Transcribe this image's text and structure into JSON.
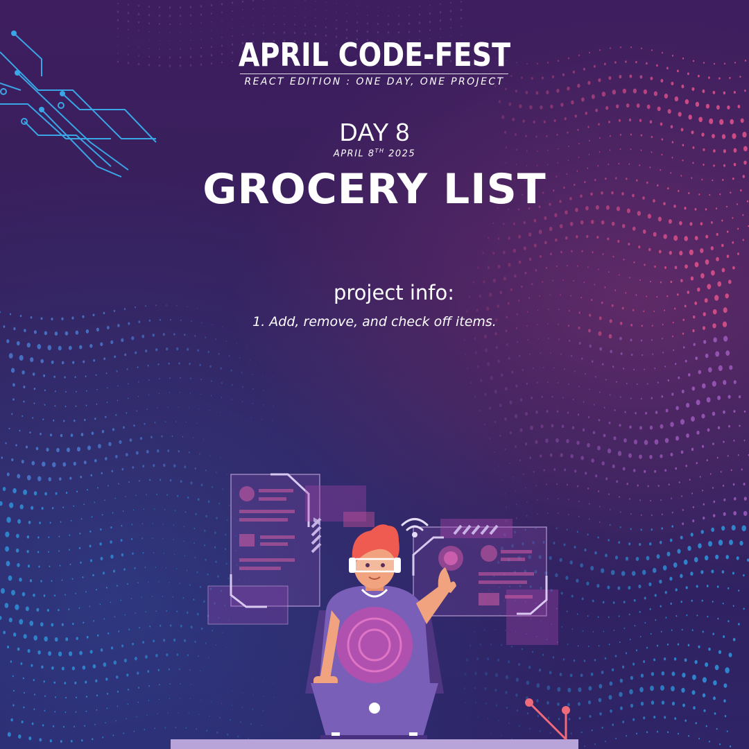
{
  "event": {
    "title": "APRIL CODE-FEST",
    "subtitle": "REACT EDITION : ONE DAY, ONE PROJECT"
  },
  "day": {
    "label": "DAY 8",
    "date_prefix": "APRIL 8",
    "date_ordinal": "TH",
    "date_year": " 2025"
  },
  "project": {
    "title": "GROCERY LIST",
    "info_heading": "project info:",
    "info_items": [
      "1.  Add, remove, and check off items."
    ]
  },
  "icons": [
    "circuit-lines-graphic",
    "wifi-icon",
    "developer-illustration",
    "laptop-icon"
  ],
  "colors": {
    "background": "#3a1d5c",
    "circuit": "#3aa6e6",
    "accent_pink": "#d9508a",
    "text": "#ffffff"
  }
}
